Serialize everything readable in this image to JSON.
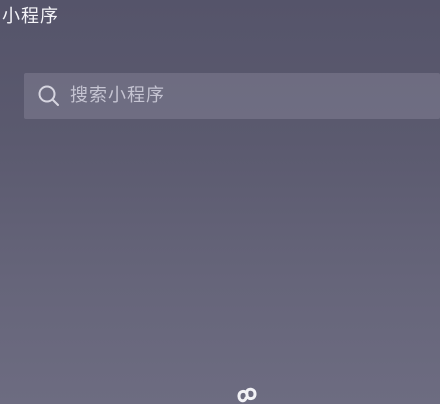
{
  "header": {
    "title": "小程序"
  },
  "search": {
    "placeholder": "搜索小程序",
    "icon": "search-icon"
  },
  "footer": {
    "icon": "mini-program-logo-icon"
  },
  "colors": {
    "background": "#5b5a6f",
    "search_bar": "#7a7990",
    "placeholder_text": "#c5c4d2",
    "title_text": "#f4f4f8"
  }
}
